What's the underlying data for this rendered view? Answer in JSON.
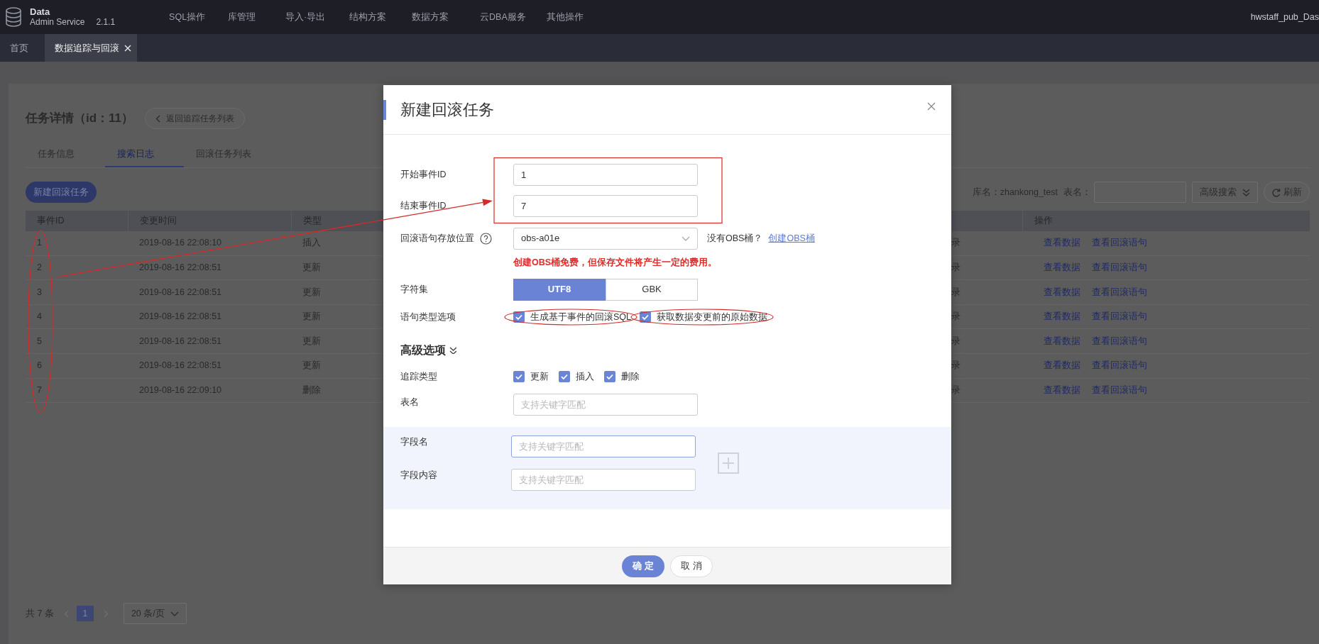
{
  "app": {
    "logo_title": "Data",
    "logo_subtitle": "Admin Service",
    "version": "2.1.1",
    "menu": [
      "SQL操作",
      "库管理",
      "导入·导出",
      "结构方案",
      "数据方案",
      "云DBA服务",
      "其他操作"
    ],
    "user": "hwstaff_pub_Das"
  },
  "tabs": [
    {
      "label": "首页",
      "selected": false,
      "closable": false
    },
    {
      "label": "数据追踪与回滚",
      "selected": true,
      "closable": true
    }
  ],
  "page": {
    "title": "任务详情（id：11）",
    "back_button": "返回追踪任务列表",
    "tabs": [
      {
        "label": "任务信息",
        "selected": false
      },
      {
        "label": "搜索日志",
        "selected": true
      },
      {
        "label": "回滚任务列表",
        "selected": false
      }
    ],
    "new_button": "新建回滚任务",
    "db_label": "库名：zhankong_test",
    "table_label": "表名：",
    "advanced_search": "高级搜索",
    "refresh": "刷新"
  },
  "table": {
    "columns": [
      "事件ID",
      "变更时间",
      "类型",
      "操作"
    ],
    "id_column_circled": true,
    "rows": [
      {
        "event_id": "1",
        "time": "2019-08-16 22:08:10",
        "type": "插入",
        "column_4": "录",
        "actions": [
          "查看数据",
          "查看回滚语句"
        ]
      },
      {
        "event_id": "2",
        "time": "2019-08-16 22:08:51",
        "type": "更新",
        "column_4": "录",
        "actions": [
          "查看数据",
          "查看回滚语句"
        ]
      },
      {
        "event_id": "3",
        "time": "2019-08-16 22:08:51",
        "type": "更新",
        "column_4": "录",
        "actions": [
          "查看数据",
          "查看回滚语句"
        ]
      },
      {
        "event_id": "4",
        "time": "2019-08-16 22:08:51",
        "type": "更新",
        "column_4": "录",
        "actions": [
          "查看数据",
          "查看回滚语句"
        ]
      },
      {
        "event_id": "5",
        "time": "2019-08-16 22:08:51",
        "type": "更新",
        "column_4": "录",
        "actions": [
          "查看数据",
          "查看回滚语句"
        ]
      },
      {
        "event_id": "6",
        "time": "2019-08-16 22:08:51",
        "type": "更新",
        "column_4": "录",
        "actions": [
          "查看数据",
          "查看回滚语句"
        ]
      },
      {
        "event_id": "7",
        "time": "2019-08-16 22:09:10",
        "type": "删除",
        "column_4": "录",
        "actions": [
          "查看数据",
          "查看回滚语句"
        ]
      }
    ]
  },
  "pagination": {
    "total": "共 7 条",
    "pages": [
      {
        "label": "1",
        "selected": true
      }
    ],
    "page_size": "20 条/页"
  },
  "dialog": {
    "title": "新建回滚任务",
    "id_fields_boxed": true,
    "arrow": true,
    "fields": [
      {
        "label": "开始事件ID",
        "value": "1"
      },
      {
        "label": "结束事件ID",
        "value": "7"
      }
    ],
    "location": {
      "label": "回滚语句存放位置",
      "value": "obs-a01e",
      "hint": "没有OBS桶？",
      "link": "创建OBS桶",
      "warning": "创建OBS桶免费，但保存文件将产生一定的费用。"
    },
    "charset": {
      "label": "字符集",
      "options": [
        {
          "label": "UTF8",
          "selected": true
        },
        {
          "label": "GBK",
          "selected": false
        }
      ]
    },
    "statement_options": {
      "label": "语句类型选项",
      "options": [
        {
          "label": "生成基于事件的回滚SQL",
          "checked": true,
          "circled": true
        },
        {
          "label": "获取数据变更前的原始数据",
          "checked": true,
          "circled": true
        }
      ]
    },
    "advanced": {
      "title": "高级选项",
      "expanded": true
    },
    "track_types": {
      "label": "追踪类型",
      "options": [
        {
          "label": "更新",
          "checked": true
        },
        {
          "label": "插入",
          "checked": true
        },
        {
          "label": "删除",
          "checked": true
        }
      ]
    },
    "table_name": {
      "label": "表名",
      "placeholder": "支持关键字匹配"
    },
    "field_filter": {
      "name_label": "字段名",
      "name_placeholder": "支持关键字匹配",
      "content_label": "字段内容",
      "content_placeholder": "支持关键字匹配"
    },
    "buttons": [
      {
        "label": "确 定",
        "kind": "primary"
      },
      {
        "label": "取 消",
        "kind": "secondary"
      }
    ]
  }
}
